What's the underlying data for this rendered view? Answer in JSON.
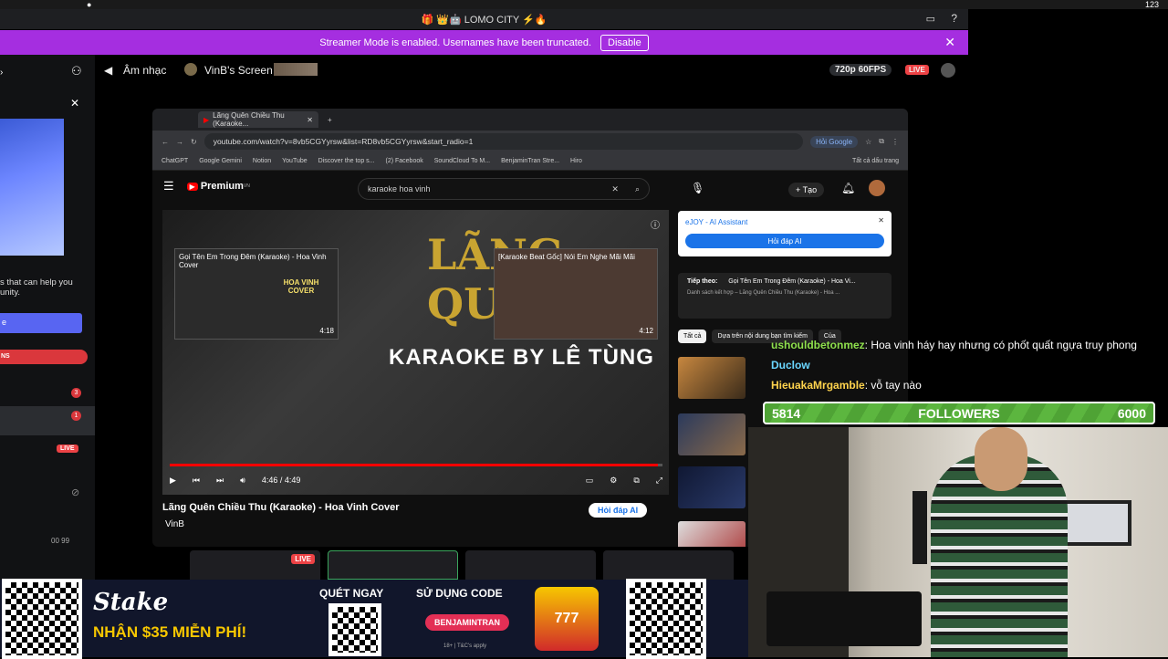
{
  "titlebar": {
    "title": "🎁 👑🤖 LOMO CITY ⚡🔥"
  },
  "macbar": {
    "right_count": "123"
  },
  "banner": {
    "text": "Streamer Mode is enabled. Usernames have been truncated.",
    "disable": "Disable",
    "close": "✕"
  },
  "voice": {
    "channel": "Âm nhạc",
    "screen": "VinB's Screen",
    "quality": "720p 60FPS",
    "live": "LIVE"
  },
  "sidebar": {
    "text": "s that can help you\nunity.",
    "badges": [
      "3",
      "1"
    ],
    "live": "LIVE",
    "footer": "00  99",
    "label_red": "NS",
    "button": "e"
  },
  "browser": {
    "tab_title": "Lãng Quên Chiều Thu (Karaoke...",
    "url": "youtube.com/watch?v=8vb5CGYyrsw&list=RD8vb5CGYyrsw&start_radio=1",
    "google_btn": "Hỏi Google",
    "bookmarks": [
      "ChatGPT",
      "Google Gemini",
      "Notion",
      "YouTube",
      "Discover the top s...",
      "(2) Facebook",
      "SoundCloud To M...",
      "BenjaminTran Stre...",
      "Hiro",
      "Tất cả dấu trang"
    ]
  },
  "youtube": {
    "logo": "Premium",
    "logo_sup": "VN",
    "search": "karaoke hoa vinh",
    "create": "Tạo",
    "video_text1": "LÃNG QUÊN",
    "video_text2": "KARAOKE BY LÊ TÙNG",
    "thumbA_title": "Gọi Tên Em Trong Đêm (Karaoke) - Hoa Vinh Cover",
    "thumbA_badge": "HOA VINH COVER",
    "thumbA_duration": "4:18",
    "thumbB_title": "[Karaoke Beat Gốc] Nói Em Nghe Mãi Mãi",
    "thumbB_duration": "4:12",
    "time": "4:46 / 4:49",
    "progress": 0.99,
    "title": "Lãng Quên Chiều Thu (Karaoke) - Hoa Vinh Cover",
    "channel": "VinB",
    "ask_ai": "Hỏi đáp AI"
  },
  "ai_panel": {
    "title": "eJOY - AI Assistant",
    "button": "Hỏi đáp AI"
  },
  "playlist": {
    "label": "Tiếp theo:",
    "next": "Gọi Tên Em Trong Đêm (Karaoke) - Hoa Vi...",
    "sub": "Danh sách kết hợp – Lãng Quên Chiều Thu (Karaoke) - Hoa ..."
  },
  "chips": [
    "Tất cả",
    "Dựa trên nội dung bạn tìm kiếm",
    "Của"
  ],
  "chat": [
    {
      "user": "ushouldbetonmez",
      "msg": ": Hoa vinh háy hay nhưng có phốt quất ngựa truy phong"
    },
    {
      "user": "Duclow",
      "msg": ""
    },
    {
      "user": "HieuakaMrgamble",
      "msg": ": vỗ tay nào"
    }
  ],
  "followers": {
    "current": "5814",
    "label": "FOLLOWERS",
    "goal": "6000"
  },
  "ad": {
    "brand": "Stake",
    "promo": "NHẬN $35 MIỄN PHÍ!",
    "scan": "QUÉT NGAY",
    "use_code": "SỬ DỤNG CODE",
    "code": "BENJAMINTRAN",
    "slots": "777",
    "terms": "18+ | T&C's apply"
  },
  "bottom": {
    "live": "LIVE"
  },
  "colors": {
    "banner": "#a52ee0",
    "live": "#ed4245",
    "followers": "#4fa335",
    "ai": "#1a73e8"
  }
}
